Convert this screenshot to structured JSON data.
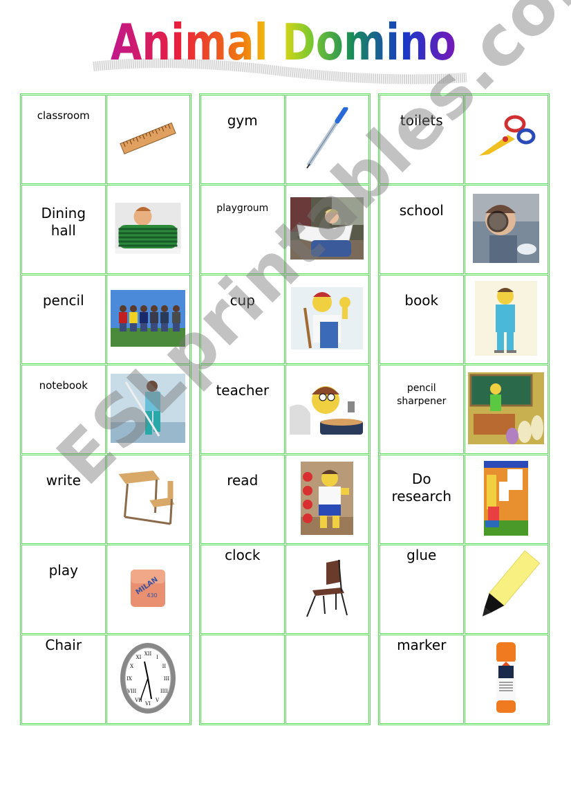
{
  "title": "Animal Domino",
  "title_gradient": [
    "#c0188c",
    "#e8203c",
    "#f07a10",
    "#f0d810",
    "#7ac830",
    "#1a8a5a",
    "#1838c8",
    "#7818b8"
  ],
  "border_color": "#55dd55",
  "watermark": "ESLprintables.com",
  "columns": [
    {
      "cards": [
        {
          "word": "classroom",
          "picture": "ruler"
        },
        {
          "word": "Dining hall",
          "picture": "boy-writing"
        },
        {
          "word": "pencil",
          "picture": "children-playing"
        },
        {
          "word": "notebook",
          "picture": "cleaner-mopping"
        },
        {
          "word": "write",
          "picture": "school-desk"
        },
        {
          "word": "play",
          "picture": "eraser"
        },
        {
          "word": "Chair",
          "picture": "clock"
        }
      ]
    },
    {
      "cards": [
        {
          "word": "gym",
          "picture": "pen"
        },
        {
          "word": "playgroum",
          "picture": "boy-reading"
        },
        {
          "word": "cup",
          "picture": "janitor-cartoon"
        },
        {
          "word": "teacher",
          "picture": "lunch-lady-cartoon"
        },
        {
          "word": "read",
          "picture": "gym-coach-cartoon"
        },
        {
          "word": "clock",
          "picture": "chair"
        },
        {
          "word": "",
          "picture": ""
        }
      ]
    },
    {
      "cards": [
        {
          "word": "toilets",
          "picture": "scissors"
        },
        {
          "word": "school",
          "picture": "boy-magnifier"
        },
        {
          "word": "book",
          "picture": "principal-cartoon"
        },
        {
          "word": "pencil sharpener",
          "picture": "teacher-classroom-cartoon"
        },
        {
          "word": "Do research",
          "picture": "library-cartoon"
        },
        {
          "word": "glue",
          "picture": "highlighter"
        },
        {
          "word": "marker",
          "picture": "glue-stick"
        }
      ]
    }
  ],
  "eraser_label": "MILAN 430"
}
